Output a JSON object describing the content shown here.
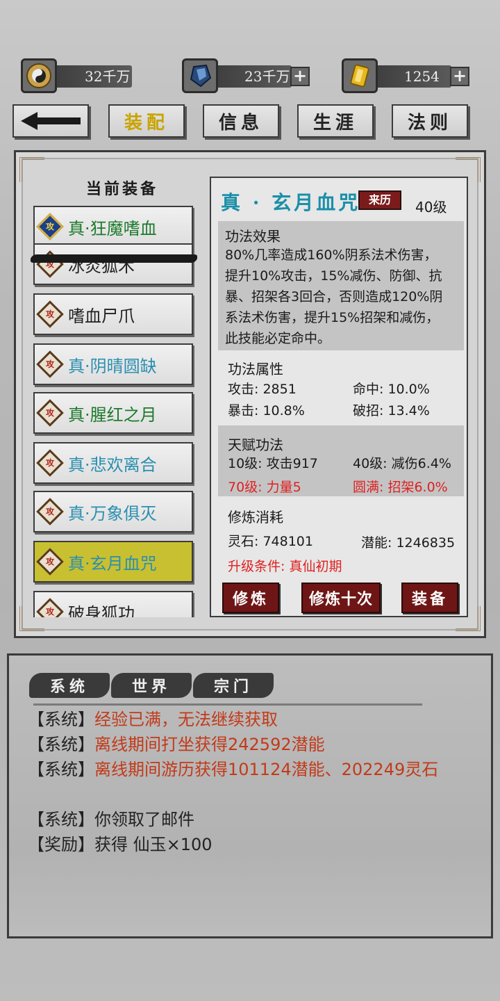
{
  "resources": [
    {
      "icon": "taiji-coin-icon",
      "value": "32千万",
      "has_plus": false
    },
    {
      "icon": "spirit-crystal-icon",
      "value": "23千万",
      "has_plus": true
    },
    {
      "icon": "gold-jade-icon",
      "value": "1254",
      "has_plus": true
    }
  ],
  "tabs": {
    "back_icon": "back-arrow-icon",
    "equip": "装配",
    "info": "信息",
    "career": "生涯",
    "law": "法则"
  },
  "equipment": {
    "title": "当前装备",
    "items": [
      {
        "label": "真·狂魔嗜血",
        "color": "#1c7a2c",
        "icon_badge": "攻"
      },
      {
        "label": "冰炎狐术",
        "color": "#222222",
        "icon_badge": "攻"
      },
      {
        "label": "嗜血尸爪",
        "color": "#222222",
        "icon_badge": "攻"
      },
      {
        "label": "真·阴晴圆缺",
        "color": "#2a8fb0",
        "icon_badge": "攻"
      },
      {
        "label": "真·腥红之月",
        "color": "#1c7a2c",
        "icon_badge": "攻"
      },
      {
        "label": "真·悲欢离合",
        "color": "#2a8fb0",
        "icon_badge": "攻"
      },
      {
        "label": "真·万象俱灭",
        "color": "#2a8fb0",
        "icon_badge": "攻"
      },
      {
        "label": "真·玄月血咒",
        "color": "#2a8fb0",
        "icon_badge": "攻"
      },
      {
        "label": "破身狐功",
        "color": "#222222",
        "icon_badge": "攻"
      }
    ]
  },
  "detail": {
    "name": "真 · 玄月血咒",
    "origin_button": "来历",
    "level": "40级",
    "effect_title": "功法效果",
    "effect_lines": [
      "80%几率造成160%阴系法术伤害，",
      "提升10%攻击，15%减伤、防御、抗",
      "暴、招架各3回合，否则造成120%阴",
      "系法术伤害，提升15%招架和减伤，",
      "此技能必定命中。"
    ],
    "attr_title": "功法属性",
    "attrs": {
      "attack": "攻击: 2851",
      "hit": "命中: 10.0%",
      "crit": "暴击: 10.8%",
      "pierce": "破招: 13.4%"
    },
    "talent_title": "天赋功法",
    "talents": {
      "t10": "10级: 攻击917",
      "t40": "40级: 减伤6.4%",
      "t70": "70级: 力量5",
      "tmax": "圆满: 招架6.0%"
    },
    "cost_title": "修炼消耗",
    "cost": {
      "stone": "灵石: 748101",
      "potential": "潜能: 1246835",
      "requirement": "升级条件: 真仙初期"
    },
    "buttons": {
      "train": "修炼",
      "train_ten": "修炼十次",
      "equip": "装备"
    }
  },
  "chat": {
    "tabs": [
      "系统",
      "世界",
      "宗门"
    ],
    "messages": [
      {
        "tag": "【系统】",
        "text": "经验已满，无法继续获取",
        "tone": "orange"
      },
      {
        "tag": "【系统】",
        "text": "离线期间打坐获得242592潜能",
        "tone": "orange"
      },
      {
        "tag": "【系统】",
        "text": "离线期间游历获得101124潜能、202249灵石",
        "tone": "orange"
      },
      {
        "tag": "【系统】",
        "text": "你领取了邮件",
        "tone": "normal"
      },
      {
        "tag": "【奖励】",
        "text": "获得 仙玉×100",
        "tone": "normal"
      }
    ]
  }
}
